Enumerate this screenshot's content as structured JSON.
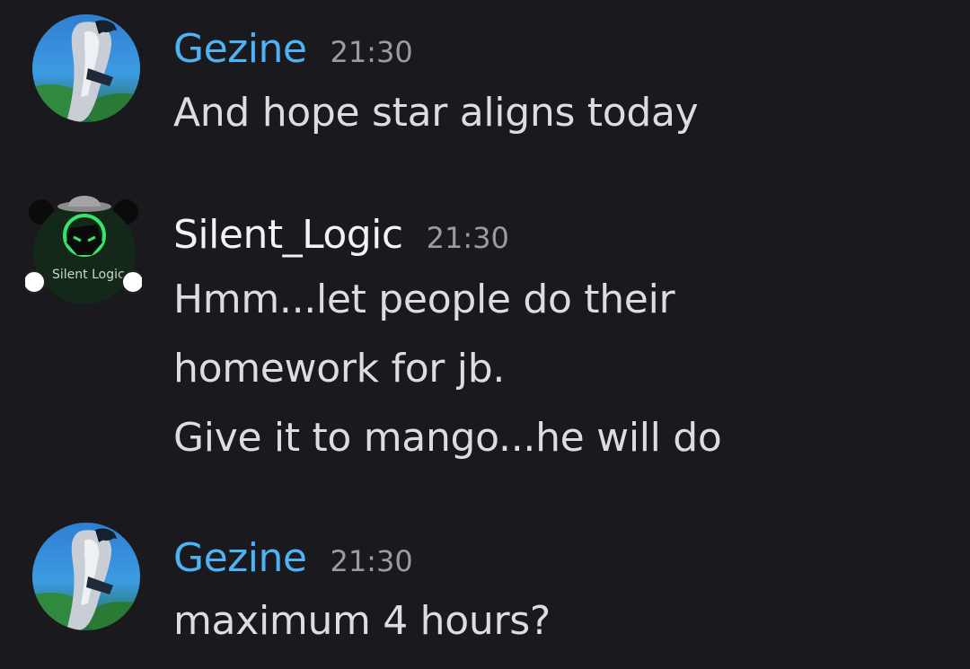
{
  "theme": {
    "background": "#1a1a1e",
    "gezine_name_color": "#4eb3f5",
    "silent_name_color": "#f2f3f5",
    "text_color": "#dbdee1",
    "timestamp_color": "#9b9ca3"
  },
  "messages": [
    {
      "author": "Gezine",
      "time": "21:30",
      "avatar_icon": "anime-girl-avatar-icon",
      "lines": [
        "And hope star aligns today"
      ]
    },
    {
      "author": "Silent_Logic",
      "time": "21:30",
      "avatar_icon": "hooded-hacker-logo-avatar-icon",
      "avatar_text": "Silent Logic",
      "lines": [
        "Hmm...let people do their",
        "homework for jb.",
        "Give it to mango...he will do"
      ]
    },
    {
      "author": "Gezine",
      "time": "21:30",
      "avatar_icon": "anime-girl-avatar-icon",
      "lines": [
        "maximum 4 hours?"
      ]
    }
  ]
}
